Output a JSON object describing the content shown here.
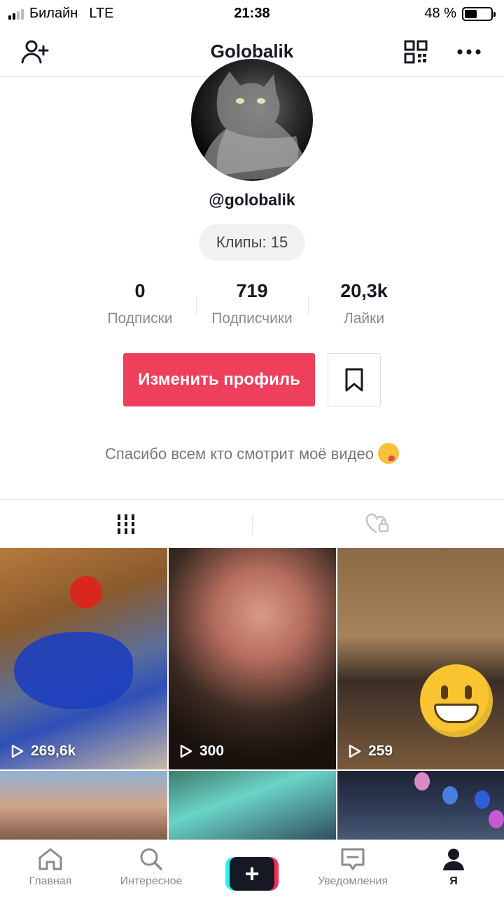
{
  "status_bar": {
    "carrier": "Билайн",
    "network": "LTE",
    "time": "21:38",
    "battery_text": "48 %",
    "battery_level": 0.48
  },
  "header": {
    "title": "Golobalik",
    "add_user_icon": "person-add-icon",
    "qr_icon": "qr-code-icon",
    "more_icon": "more-dots-icon"
  },
  "profile": {
    "username": "@golobalik",
    "clips_label": "Клипы: 15",
    "stats": [
      {
        "value": "0",
        "label": "Подписки"
      },
      {
        "value": "719",
        "label": "Подписчики"
      },
      {
        "value": "20,3k",
        "label": "Лайки"
      }
    ],
    "edit_button": "Изменить профиль",
    "bio": "Спасибо всем кто смотрит моё видео"
  },
  "tabs": [
    {
      "icon": "videos-grid-icon",
      "active": true
    },
    {
      "icon": "liked-private-icon",
      "active": false
    }
  ],
  "videos": [
    {
      "views": "269,6k"
    },
    {
      "views": "300"
    },
    {
      "views": "259"
    },
    {
      "views": ""
    },
    {
      "views": ""
    },
    {
      "views": ""
    }
  ],
  "bottom_nav": {
    "home": "Главная",
    "discover": "Интересное",
    "notifications": "Уведомления",
    "me": "Я"
  },
  "colors": {
    "accent": "#ee3f5c",
    "text_primary": "#161823",
    "text_secondary": "#8a8b91"
  }
}
